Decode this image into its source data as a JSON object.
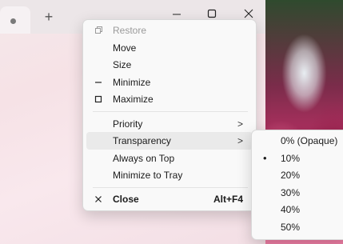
{
  "browser": {
    "new_tab_symbol": "+",
    "window_controls": {
      "minimize_icon": "minimize-icon",
      "maximize_icon": "maximize-icon",
      "close_icon": "close-icon"
    }
  },
  "menu": {
    "restore": {
      "label": "Restore",
      "icon": "restore-icon"
    },
    "move": {
      "label": "Move"
    },
    "size": {
      "label": "Size"
    },
    "minimize": {
      "label": "Minimize",
      "icon": "minimize-icon"
    },
    "maximize": {
      "label": "Maximize",
      "icon": "maximize-icon"
    },
    "priority": {
      "label": "Priority",
      "chevron": ">"
    },
    "transparency": {
      "label": "Transparency",
      "chevron": ">"
    },
    "always_on_top": {
      "label": "Always on Top"
    },
    "minimize_to_tray": {
      "label": "Minimize to Tray"
    },
    "close": {
      "label": "Close",
      "accelerator": "Alt+F4",
      "icon": "close-icon"
    }
  },
  "transparency_submenu": {
    "items": [
      {
        "label": "0% (Opaque)",
        "selected": false
      },
      {
        "label": "10%",
        "selected": true,
        "bullet": "•"
      },
      {
        "label": "20%",
        "selected": false
      },
      {
        "label": "30%",
        "selected": false
      },
      {
        "label": "40%",
        "selected": false
      },
      {
        "label": "50%",
        "selected": false
      }
    ]
  }
}
